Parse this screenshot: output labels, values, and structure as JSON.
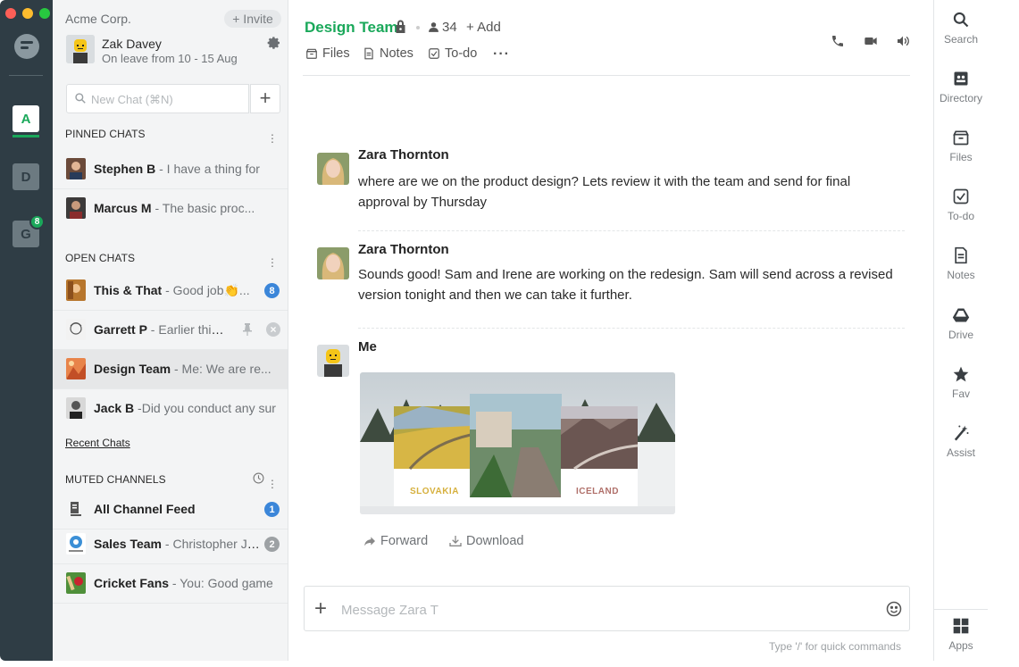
{
  "rail": {
    "workspaces": [
      {
        "letter": "A",
        "active": true
      },
      {
        "letter": "D",
        "active": false
      },
      {
        "letter": "G",
        "active": false,
        "badge": "8"
      }
    ]
  },
  "sidebar": {
    "org": "Acme Corp.",
    "invite_label": "+ Invite",
    "profile": {
      "name": "Zak Davey",
      "status": "On leave from 10 - 15 Aug"
    },
    "search_placeholder": "New Chat (⌘N)",
    "pinned_header": "PINNED CHATS",
    "pinned": [
      {
        "name": "Stephen B",
        "preview": " - I have a thing for"
      },
      {
        "name": "Marcus M",
        "preview": " - The basic proc..."
      }
    ],
    "open_header": "OPEN CHATS",
    "open": [
      {
        "name": "This & That",
        "preview": " - Good job👏...",
        "badge": "8"
      },
      {
        "name": "Garrett P",
        "preview": " - Earlier this..."
      },
      {
        "name": "Design Team",
        "preview": " - Me: We are re..."
      },
      {
        "name": "Jack B",
        "preview": " -Did you conduct any sur"
      }
    ],
    "recent_link": "Recent Chats",
    "muted_header": "MUTED CHANNELS",
    "muted": [
      {
        "name": "All Channel Feed",
        "preview": "",
        "badge": "1"
      },
      {
        "name": "Sales Team",
        "preview": " - Christopher J: d...",
        "badge": "2"
      },
      {
        "name": "Cricket Fans",
        "preview": " - You: Good game"
      }
    ]
  },
  "header": {
    "title": "Design Team",
    "members": "34",
    "add_label": "+ Add",
    "tabs": [
      "Files",
      "Notes",
      "To-do"
    ],
    "more": "···"
  },
  "messages": [
    {
      "sender": "Zara Thornton",
      "text": "where are we on the product design? Lets review it with the team and send for final approval by Thursday"
    },
    {
      "sender": "Zara Thornton",
      "text": "Sounds good! Sam and Irene are working on the redesign. Sam will send across a revised version tonight and then we can take it further."
    },
    {
      "sender": "Me",
      "image_labels": {
        "left": "SLOVAKIA",
        "right": "ICELAND"
      },
      "actions": {
        "forward": "Forward",
        "download": "Download"
      }
    }
  ],
  "composer": {
    "placeholder": "Message Zara T",
    "hint": "Type '/' for quick commands"
  },
  "rightbar": [
    {
      "label": "Search",
      "icon": "search-icon"
    },
    {
      "label": "Directory",
      "icon": "directory-icon"
    },
    {
      "label": "Files",
      "icon": "files-icon"
    },
    {
      "label": "To-do",
      "icon": "todo-icon"
    },
    {
      "label": "Notes",
      "icon": "notes-icon"
    },
    {
      "label": "Drive",
      "icon": "drive-icon"
    },
    {
      "label": "Fav",
      "icon": "star-icon"
    },
    {
      "label": "Assist",
      "icon": "magic-wand-icon"
    },
    {
      "label": "Apps",
      "icon": "apps-grid-icon"
    }
  ],
  "colors": {
    "accent": "#1aa85a",
    "rail": "#2f3d45",
    "badge_blue": "#3b86d9"
  }
}
